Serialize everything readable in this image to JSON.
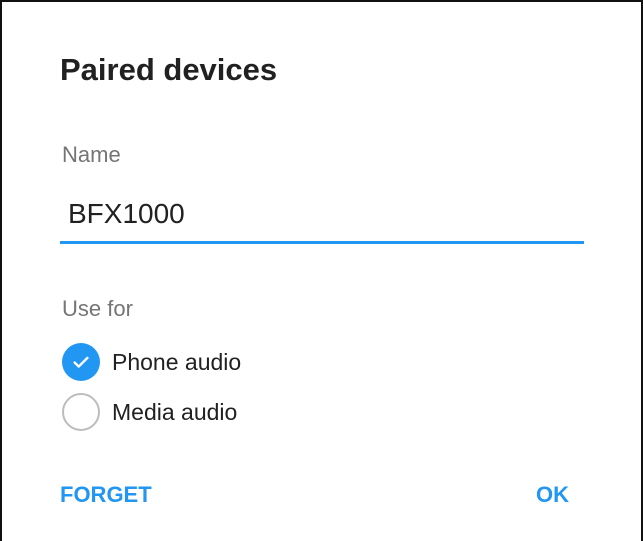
{
  "dialog": {
    "title": "Paired devices",
    "name_label": "Name",
    "name_value": "BFX1000",
    "use_for_label": "Use for",
    "options": [
      {
        "label": "Phone audio",
        "checked": true
      },
      {
        "label": "Media audio",
        "checked": false
      }
    ],
    "buttons": {
      "forget": "FORGET",
      "ok": "OK"
    }
  },
  "colors": {
    "accent": "#2196f3",
    "text_primary": "#212121",
    "text_secondary": "#757575",
    "unchecked_border": "#bdbdbd"
  },
  "icons": {
    "checked": "check-icon",
    "unchecked": "empty-circle-icon"
  }
}
